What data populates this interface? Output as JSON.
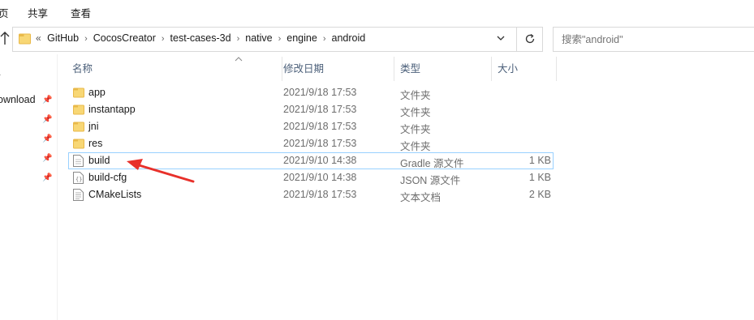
{
  "ribbon": {
    "tabs": [
      "页",
      "共享",
      "查看"
    ]
  },
  "address": {
    "overflow": "«",
    "crumbs": [
      "GitHub",
      "CocosCreator",
      "test-cases-3d",
      "native",
      "engine",
      "android"
    ]
  },
  "search": {
    "placeholder": "搜索\"android\""
  },
  "nav_pane": {
    "items": [
      "ī",
      "ownload"
    ]
  },
  "columns": {
    "name": "名称",
    "date": "修改日期",
    "type": "类型",
    "size": "大小"
  },
  "files": [
    {
      "name": "app",
      "date": "2021/9/18 17:53",
      "type": "文件夹",
      "size": "",
      "icon": "folder-icon"
    },
    {
      "name": "instantapp",
      "date": "2021/9/18 17:53",
      "type": "文件夹",
      "size": "",
      "icon": "folder-icon"
    },
    {
      "name": "jni",
      "date": "2021/9/18 17:53",
      "type": "文件夹",
      "size": "",
      "icon": "folder-icon"
    },
    {
      "name": "res",
      "date": "2021/9/18 17:53",
      "type": "文件夹",
      "size": "",
      "icon": "folder-icon"
    },
    {
      "name": "build",
      "date": "2021/9/10 14:38",
      "type": "Gradle 源文件",
      "size": "1 KB",
      "icon": "document-icon",
      "selected": true
    },
    {
      "name": "build-cfg",
      "date": "2021/9/10 14:38",
      "type": "JSON 源文件",
      "size": "1 KB",
      "icon": "json-file-icon"
    },
    {
      "name": "CMakeLists",
      "date": "2021/9/18 17:53",
      "type": "文本文档",
      "size": "2 KB",
      "icon": "text-file-icon"
    }
  ],
  "colors": {
    "folder": "#f8d775",
    "folder_dark": "#e9b949",
    "selection_border": "#99d1ff",
    "header_text": "#4c607a",
    "arrow": "#e8302a"
  }
}
